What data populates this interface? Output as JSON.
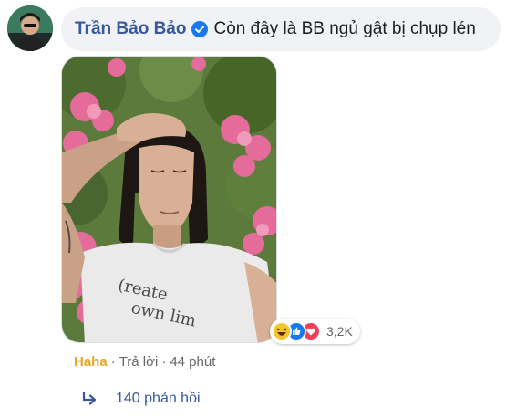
{
  "comment": {
    "author": "Trần Bảo Bảo",
    "text": "Còn đây là BB ngủ gật bị chụp lén",
    "verified_icon": "verified-badge-icon",
    "verified_color": "#1877f2",
    "author_color": "#385898"
  },
  "photo": {
    "shirt_text_line1": "(reate",
    "shirt_text_line2": "own lim"
  },
  "reactions": {
    "icons": [
      "haha-reaction-icon",
      "like-reaction-icon",
      "love-reaction-icon"
    ],
    "count": "3,2K"
  },
  "actions": {
    "reaction_label": "Haha",
    "reaction_color": "#e9a82a",
    "separator": "·",
    "reply_label": "Trả lời",
    "time": "44 phút"
  },
  "replies": {
    "icon": "reply-arrow-icon",
    "label": "140 phản hồi"
  }
}
